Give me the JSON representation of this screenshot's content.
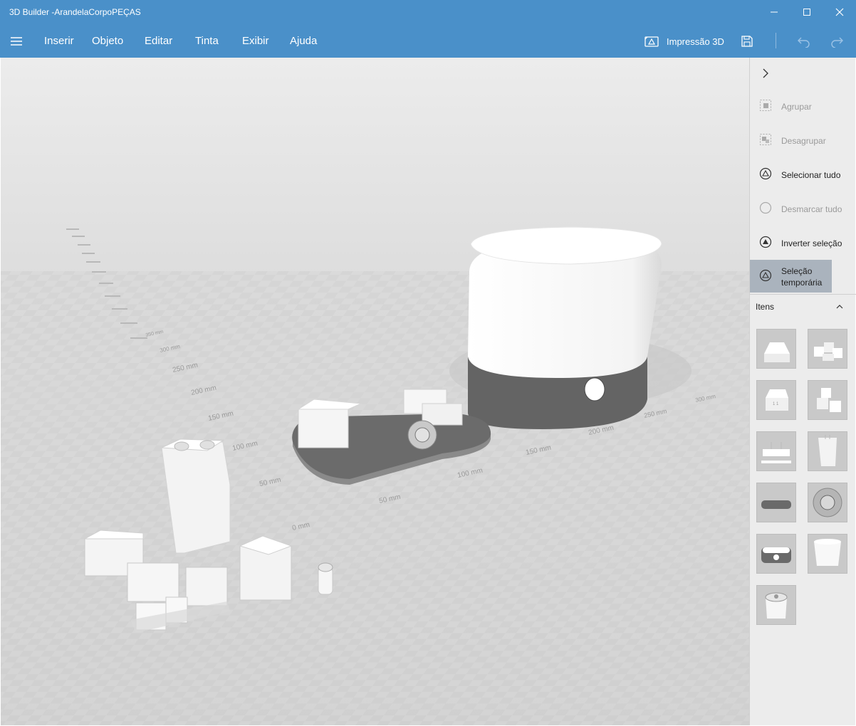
{
  "window": {
    "title": "3D Builder -ArandelaCorpoPEÇAS"
  },
  "menu": {
    "items": [
      {
        "label": "Inserir"
      },
      {
        "label": "Objeto"
      },
      {
        "label": "Editar"
      },
      {
        "label": "Tinta"
      },
      {
        "label": "Exibir"
      },
      {
        "label": "Ajuda"
      }
    ],
    "print_label": "Impressão 3D"
  },
  "viewport": {
    "ruler_x": [
      "0 mm",
      "50 mm",
      "100 mm",
      "150 mm",
      "200 mm",
      "250 mm",
      "300 mm"
    ],
    "ruler_y": [
      "50 mm",
      "100 mm",
      "150 mm",
      "200 mm",
      "250 mm",
      "300 mm",
      "350 mm"
    ]
  },
  "panel": {
    "actions": [
      {
        "label": "Agrupar",
        "icon": "group-icon",
        "enabled": false
      },
      {
        "label": "Desagrupar",
        "icon": "ungroup-icon",
        "enabled": false
      },
      {
        "label": "Selecionar tudo",
        "icon": "select-all-icon",
        "enabled": true
      },
      {
        "label": "Desmarcar tudo",
        "icon": "deselect-all-icon",
        "enabled": false
      },
      {
        "label": "Inverter seleção",
        "icon": "invert-selection-icon",
        "enabled": true
      },
      {
        "label": "Seleção temporária",
        "icon": "temporary-selection-icon",
        "enabled": true,
        "active": true
      }
    ],
    "items_header": "Itens"
  },
  "colors": {
    "titlebar": "#4a90c9",
    "viewport": "#dedede",
    "panel": "#ececec",
    "active_item": "#aab3bd"
  }
}
